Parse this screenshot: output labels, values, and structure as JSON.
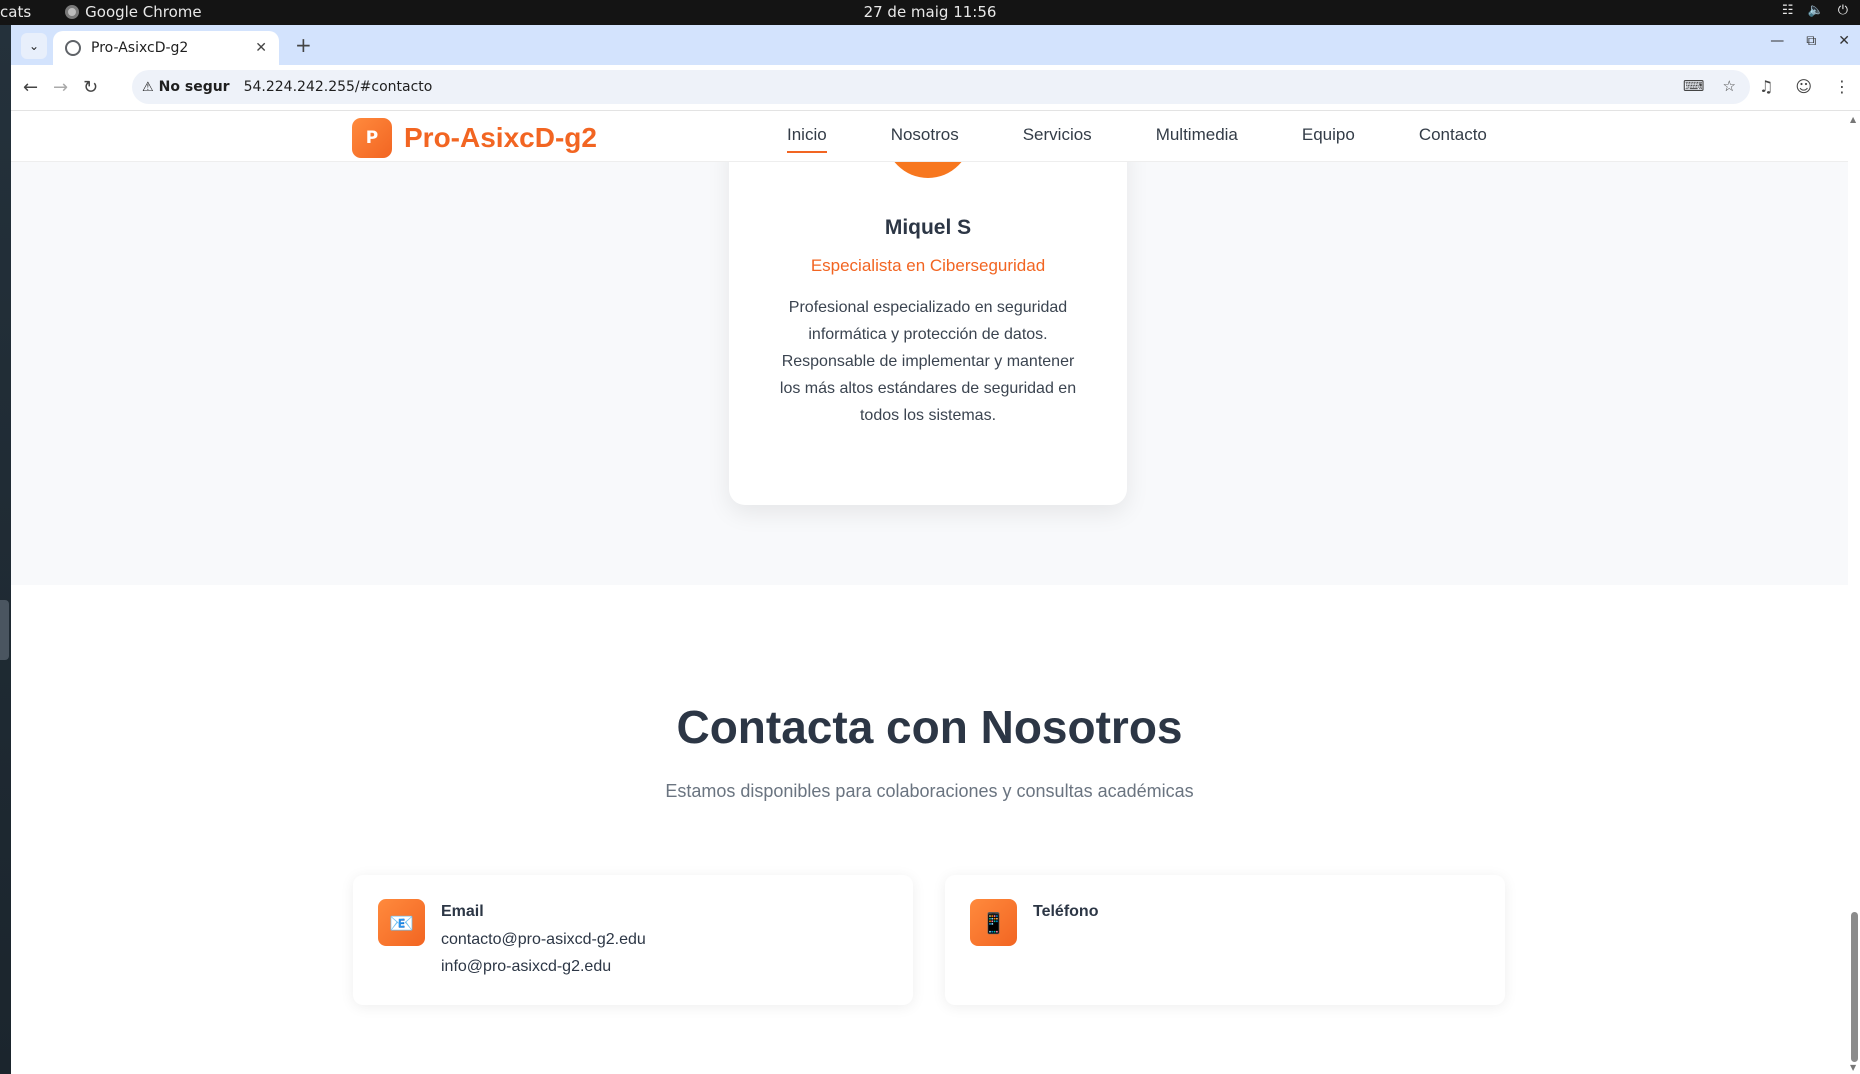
{
  "os": {
    "activities": "cats",
    "app_name": "Google Chrome",
    "clock": "27 de maig  11:56",
    "tray_icons": [
      "network-icon",
      "volume-icon",
      "power-icon"
    ]
  },
  "browser": {
    "tab_title": "Pro-AsixcD-g2",
    "security_label": "No segur",
    "url": "54.224.242.255/#contacto"
  },
  "site": {
    "logo_letter": "P",
    "brand_name": "Pro-AsixcD-g2",
    "nav": [
      "Inicio",
      "Nosotros",
      "Servicios",
      "Multimedia",
      "Equipo",
      "Contacto"
    ],
    "active_nav": "Inicio",
    "accent_color": "#f26522"
  },
  "team_member": {
    "name": "Miquel S",
    "role": "Especialista en Ciberseguridad",
    "bio": "Profesional especializado en seguridad informática y protección de datos. Responsable de implementar y mantener los más altos estándares de seguridad en todos los sistemas."
  },
  "contact": {
    "title": "Contacta con Nosotros",
    "subtitle": "Estamos disponibles para colaboraciones y consultas académicas",
    "email": {
      "icon": "📧",
      "label": "Email",
      "line1": "contacto@pro-asixcd-g2.edu",
      "line2": "info@pro-asixcd-g2.edu"
    },
    "phone": {
      "icon": "📱",
      "label": "Teléfono"
    }
  }
}
